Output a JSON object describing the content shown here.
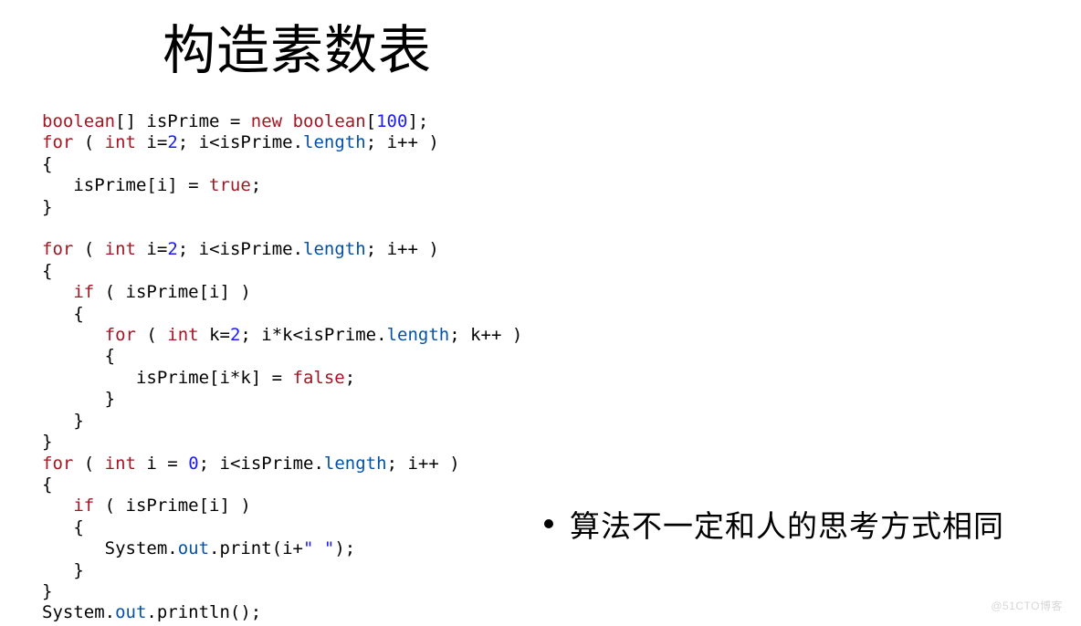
{
  "title": "构造素数表",
  "bullet": "算法不一定和人的思考方式相同",
  "watermark": "@51CTO博客",
  "code": {
    "l01_a": "boolean",
    "l01_b": "[] isPrime = ",
    "l01_c": "new",
    "l01_d": " ",
    "l01_e": "boolean",
    "l01_f": "[",
    "l01_g": "100",
    "l01_h": "];",
    "l02_a": "for",
    "l02_b": " ( ",
    "l02_c": "int",
    "l02_d": " i=",
    "l02_e": "2",
    "l02_f": "; i<isPrime.",
    "l02_g": "length",
    "l02_h": "; i++ )",
    "l03": "{",
    "l04_a": "   isPrime[i] = ",
    "l04_b": "true",
    "l04_c": ";",
    "l05": "}",
    "l06": "",
    "l07_a": "for",
    "l07_b": " ( ",
    "l07_c": "int",
    "l07_d": " i=",
    "l07_e": "2",
    "l07_f": "; i<isPrime.",
    "l07_g": "length",
    "l07_h": "; i++ )",
    "l08": "{",
    "l09_a": "   ",
    "l09_b": "if",
    "l09_c": " ( isPrime[i] )",
    "l10": "   {",
    "l11_a": "      ",
    "l11_b": "for",
    "l11_c": " ( ",
    "l11_d": "int",
    "l11_e": " k=",
    "l11_f": "2",
    "l11_g": "; i*k<isPrime.",
    "l11_h": "length",
    "l11_i": "; k++ )",
    "l12": "      {",
    "l13_a": "         isPrime[i*k] = ",
    "l13_b": "false",
    "l13_c": ";",
    "l14": "      }",
    "l15": "   }",
    "l16": "}",
    "l17_a": "for",
    "l17_b": " ( ",
    "l17_c": "int",
    "l17_d": " i = ",
    "l17_e": "0",
    "l17_f": "; i<isPrime.",
    "l17_g": "length",
    "l17_h": "; i++ )",
    "l18": "{",
    "l19_a": "   ",
    "l19_b": "if",
    "l19_c": " ( isPrime[i] )",
    "l20": "   {",
    "l21_a": "      System.",
    "l21_b": "out",
    "l21_c": ".print(i+",
    "l21_d": "\" \"",
    "l21_e": ");",
    "l22": "   }",
    "l23": "}",
    "l24_a": "System.",
    "l24_b": "out",
    "l24_c": ".println();"
  }
}
